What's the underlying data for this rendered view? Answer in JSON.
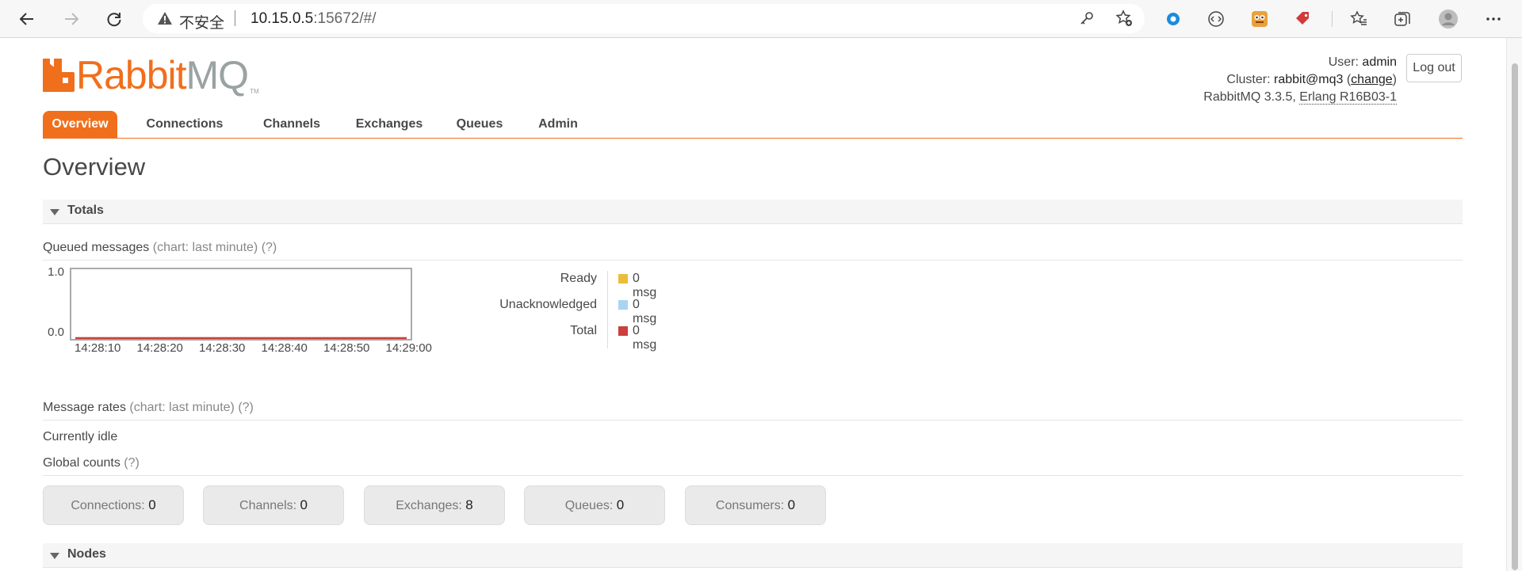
{
  "browser": {
    "security_label": "不安全",
    "url_host": "10.15.0.5",
    "url_path": ":15672/#/"
  },
  "header": {
    "logo_rabbit": "Rabbit",
    "logo_mq": "MQ",
    "logo_tm": "TM",
    "user_label": "User:",
    "user_value": "admin",
    "cluster_label": "Cluster:",
    "cluster_value": "rabbit@mq3",
    "cluster_change": "change",
    "version_text": "RabbitMQ 3.3.5,",
    "erlang_text": "Erlang R16B03-1",
    "logout_label": "Log out"
  },
  "tabs": [
    {
      "label": "Overview",
      "active": true
    },
    {
      "label": "Connections",
      "active": false
    },
    {
      "label": "Channels",
      "active": false
    },
    {
      "label": "Exchanges",
      "active": false
    },
    {
      "label": "Queues",
      "active": false
    },
    {
      "label": "Admin",
      "active": false
    }
  ],
  "page_title": "Overview",
  "totals": {
    "section_label": "Totals",
    "queued_label": "Queued messages",
    "queued_chart_note": "(chart: last minute)",
    "queued_help": "(?)",
    "legend": [
      {
        "label": "Ready",
        "value": "0 msg",
        "color": "#ebbd3b"
      },
      {
        "label": "Unacknowledged",
        "value": "0 msg",
        "color": "#a8d4f2"
      },
      {
        "label": "Total",
        "value": "0 msg",
        "color": "#c9403d"
      }
    ],
    "rates_label": "Message rates",
    "rates_chart_note": "(chart: last minute)",
    "rates_help": "(?)",
    "idle_text": "Currently idle",
    "global_label": "Global counts",
    "global_help": "(?)",
    "counts": [
      {
        "label": "Connections:",
        "value": "0"
      },
      {
        "label": "Channels:",
        "value": "0"
      },
      {
        "label": "Exchanges:",
        "value": "8"
      },
      {
        "label": "Queues:",
        "value": "0"
      },
      {
        "label": "Consumers:",
        "value": "0"
      }
    ]
  },
  "nodes": {
    "section_label": "Nodes"
  },
  "chart_data": {
    "type": "line",
    "x": [
      "14:28:10",
      "14:28:20",
      "14:28:30",
      "14:28:40",
      "14:28:50",
      "14:29:00"
    ],
    "ylim": [
      0.0,
      1.0
    ],
    "y_ticks": [
      "1.0",
      "0.0"
    ],
    "series": [
      {
        "name": "Ready",
        "values": [
          0,
          0,
          0,
          0,
          0,
          0
        ],
        "color": "#ebbd3b"
      },
      {
        "name": "Unacknowledged",
        "values": [
          0,
          0,
          0,
          0,
          0,
          0
        ],
        "color": "#a8d4f2"
      },
      {
        "name": "Total",
        "values": [
          0,
          0,
          0,
          0,
          0,
          0
        ],
        "color": "#c9403d"
      }
    ]
  }
}
